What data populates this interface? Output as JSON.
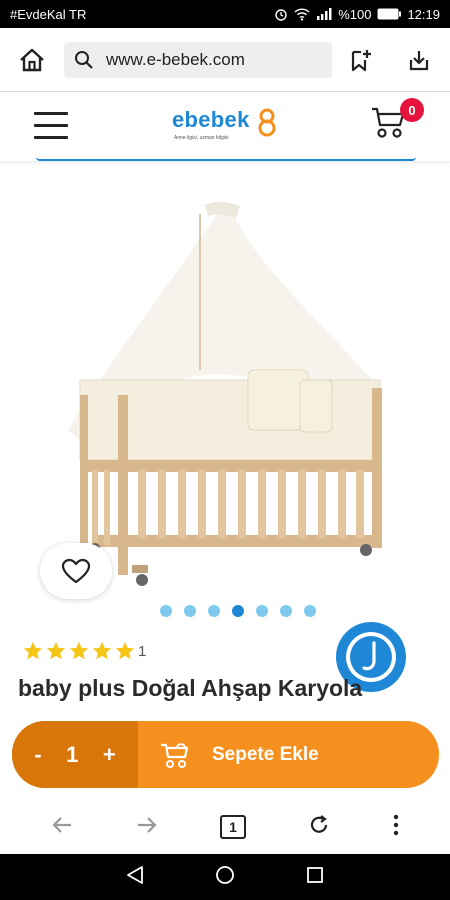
{
  "status_bar": {
    "carrier": "#EvdeKal TR",
    "battery": "%100",
    "time": "12:19"
  },
  "browser": {
    "url": "www.e-bebek.com",
    "tab_count": "1"
  },
  "site": {
    "logo_text": "ebebek",
    "logo_tagline": "Anne ilgisi, uzman bilgisi",
    "cart_count": "0"
  },
  "carousel": {
    "total_dots": 7,
    "active_index": 3
  },
  "product": {
    "rating_stars": 5,
    "review_count": "1",
    "title": "baby plus Doğal Ahşap Karyola"
  },
  "cart_bar": {
    "minus_label": "-",
    "quantity": "1",
    "plus_label": "+",
    "add_label": "Sepete Ekle"
  },
  "colors": {
    "brand_blue": "#1e88d6",
    "brand_orange": "#f5901e",
    "qty_orange": "#d9760a",
    "badge_red": "#e6143c",
    "star_yellow": "#f5c518"
  }
}
